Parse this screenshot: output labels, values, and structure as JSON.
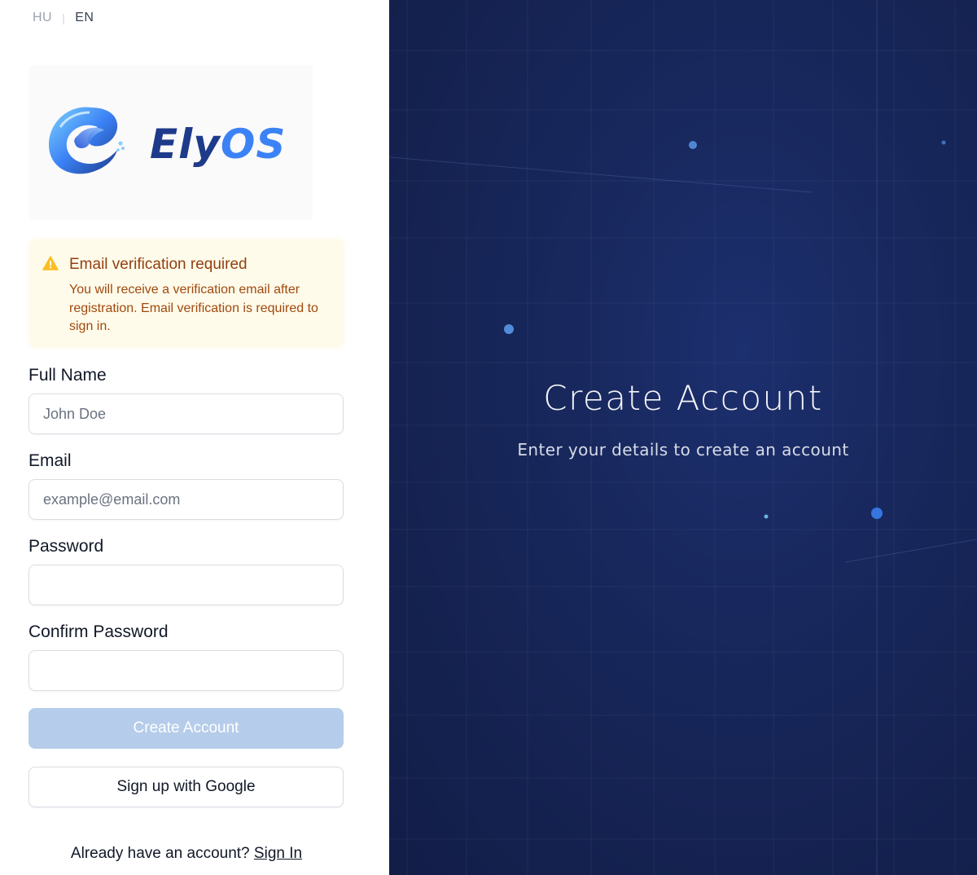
{
  "lang": {
    "hu": "HU",
    "separator": "|",
    "en": "EN"
  },
  "brand": {
    "name_part1": "Ely",
    "name_part2": "OS"
  },
  "alert": {
    "title": "Email verification required",
    "body": "You will receive a verification email after registration. Email verification is required to sign in."
  },
  "form": {
    "full_name_label": "Full Name",
    "full_name_placeholder": "John Doe",
    "email_label": "Email",
    "email_placeholder": "example@email.com",
    "password_label": "Password",
    "confirm_password_label": "Confirm Password",
    "create_button": "Create Account",
    "google_button": "Sign up with Google"
  },
  "signin": {
    "prompt": "Already have an account?",
    "link": "Sign In"
  },
  "hero": {
    "title": "Create Account",
    "subtitle": "Enter your details to create an account"
  },
  "colors": {
    "hero_bg": "#172659",
    "primary_disabled": "#b5cdea",
    "alert_bg": "#fffbeb",
    "alert_text": "#92400e",
    "brand_dark": "#1e3a8a",
    "brand_light": "#3b82f6"
  }
}
